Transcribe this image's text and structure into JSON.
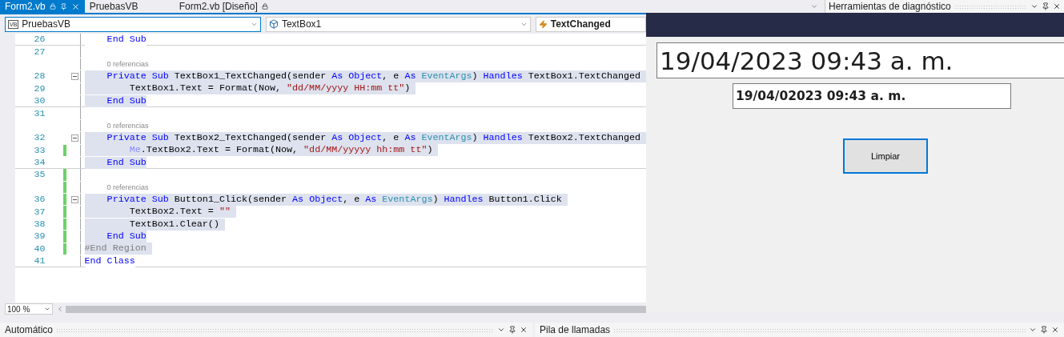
{
  "editor_tabs": [
    {
      "label": "Form2.vb",
      "selected": true,
      "locked": true,
      "pinned": true
    },
    {
      "label": "PruebasVB",
      "selected": false,
      "locked": false,
      "pinned": false
    },
    {
      "label": "Form2.vb [Diseño]",
      "selected": false,
      "locked": true,
      "pinned": false
    }
  ],
  "side_panel": {
    "title": "Herramientas de diagnóstico"
  },
  "navigation_bar": [
    {
      "kind": "project",
      "badge": "VB",
      "label": "PruebasVB",
      "focused": true
    },
    {
      "kind": "member",
      "label": "TextBox1",
      "focused": false
    },
    {
      "kind": "event",
      "label": "TextChanged",
      "focused": false
    }
  ],
  "code_lines": [
    {
      "kind": "code",
      "number": "26",
      "highlighted": false,
      "changed": false,
      "divider": true,
      "code": [
        {
          "kind": "keyword",
          "text": "    End Sub"
        }
      ]
    },
    {
      "kind": "code",
      "number": "27",
      "changed": false,
      "divider": false
    },
    {
      "kind": "lens",
      "text": "0 referencias",
      "changed": false
    },
    {
      "kind": "code",
      "number": "28",
      "highlighted": true,
      "changed": false,
      "divider": false,
      "expanded": true,
      "code": [
        {
          "kind": "keyword",
          "text": "    Private Sub"
        },
        {
          "kind": "plain",
          "text": " TextBox1_TextChanged(sender "
        },
        {
          "kind": "keyword",
          "text": "As Object"
        },
        {
          "kind": "plain",
          "text": ", e "
        },
        {
          "kind": "keyword",
          "text": "As "
        },
        {
          "kind": "type",
          "text": "EventArgs"
        },
        {
          "kind": "plain",
          "text": ") "
        },
        {
          "kind": "keyword",
          "text": "Handles"
        },
        {
          "kind": "plain",
          "text": " TextBox1.TextChanged "
        }
      ]
    },
    {
      "kind": "code",
      "number": "29",
      "highlighted": true,
      "changed": false,
      "divider": false,
      "code": [
        {
          "kind": "plain",
          "text": "        TextBox1.Text = Format(Now, "
        },
        {
          "kind": "string",
          "text": "\"dd/MM/yyyy HH:mm tt\""
        },
        {
          "kind": "plain",
          "text": ") "
        }
      ]
    },
    {
      "kind": "code",
      "number": "30",
      "highlighted": true,
      "changed": false,
      "divider": true,
      "code": [
        {
          "kind": "keyword",
          "text": "    End Sub"
        }
      ]
    },
    {
      "kind": "code",
      "number": "31",
      "changed": false,
      "divider": false
    },
    {
      "kind": "lens",
      "text": "0 referencias",
      "changed": false
    },
    {
      "kind": "code",
      "number": "32",
      "highlighted": true,
      "changed": false,
      "divider": false,
      "expanded": true,
      "code": [
        {
          "kind": "keyword",
          "text": "    Private Sub"
        },
        {
          "kind": "plain",
          "text": " TextBox2_TextChanged(sender "
        },
        {
          "kind": "keyword",
          "text": "As Object"
        },
        {
          "kind": "plain",
          "text": ", e "
        },
        {
          "kind": "keyword",
          "text": "As "
        },
        {
          "kind": "type",
          "text": "EventArgs"
        },
        {
          "kind": "plain",
          "text": ") "
        },
        {
          "kind": "keyword",
          "text": "Handles"
        },
        {
          "kind": "plain",
          "text": " TextBox2.TextChanged "
        }
      ]
    },
    {
      "kind": "code",
      "number": "33",
      "highlighted": true,
      "changed": true,
      "divider": false,
      "code": [
        {
          "kind": "me",
          "text": "        Me"
        },
        {
          "kind": "plain",
          "text": ".TextBox2.Text = Format(Now, "
        },
        {
          "kind": "string",
          "text": "\"dd/MM/yyyyy hh:mm tt\""
        },
        {
          "kind": "plain",
          "text": ") "
        }
      ]
    },
    {
      "kind": "code",
      "number": "34",
      "highlighted": true,
      "changed": false,
      "divider": true,
      "code": [
        {
          "kind": "keyword",
          "text": "    End Sub"
        }
      ]
    },
    {
      "kind": "code",
      "number": "35",
      "changed": true,
      "divider": false
    },
    {
      "kind": "lens",
      "text": "0 referencias",
      "changed": true
    },
    {
      "kind": "code",
      "number": "36",
      "highlighted": true,
      "changed": true,
      "divider": false,
      "expanded": true,
      "code": [
        {
          "kind": "keyword",
          "text": "    Private Sub"
        },
        {
          "kind": "plain",
          "text": " Button1_Click(sender "
        },
        {
          "kind": "keyword",
          "text": "As Object"
        },
        {
          "kind": "plain",
          "text": ", e "
        },
        {
          "kind": "keyword",
          "text": "As "
        },
        {
          "kind": "type",
          "text": "EventArgs"
        },
        {
          "kind": "plain",
          "text": ") "
        },
        {
          "kind": "keyword",
          "text": "Handles"
        },
        {
          "kind": "plain",
          "text": " Button1.Click "
        }
      ]
    },
    {
      "kind": "code",
      "number": "37",
      "highlighted": true,
      "changed": true,
      "divider": false,
      "code": [
        {
          "kind": "plain",
          "text": "        TextBox2.Text = "
        },
        {
          "kind": "string",
          "text": "\"\" "
        }
      ]
    },
    {
      "kind": "code",
      "number": "38",
      "highlighted": true,
      "changed": true,
      "divider": false,
      "code": [
        {
          "kind": "plain",
          "text": "        TextBox1.Clear() "
        }
      ]
    },
    {
      "kind": "code",
      "number": "39",
      "highlighted": true,
      "changed": true,
      "divider": false,
      "code": [
        {
          "kind": "keyword",
          "text": "    End Sub"
        }
      ]
    },
    {
      "kind": "code",
      "number": "40",
      "highlighted": true,
      "changed": true,
      "divider": false,
      "code": [
        {
          "kind": "preprocessor",
          "text": "#End Region "
        }
      ]
    },
    {
      "kind": "code",
      "number": "41",
      "highlighted": false,
      "changed": false,
      "divider": true,
      "code": [
        {
          "kind": "keyword",
          "text": "End Class"
        }
      ]
    }
  ],
  "zoom": {
    "value": "100 %"
  },
  "bottom_panels": [
    {
      "title": "Automático"
    },
    {
      "title": "Pila de llamadas"
    }
  ],
  "running_form": {
    "textbox_large": "19/04/2023 09:43 a. m.",
    "textbox_small": "19/04/02023 09:43 a. m.",
    "button": "Limpiar"
  }
}
